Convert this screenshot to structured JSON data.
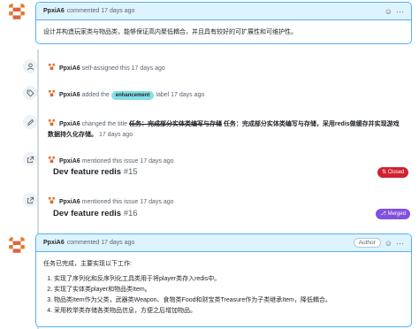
{
  "comment1": {
    "author": "PpxiA6",
    "meta": "commented 17 days ago",
    "body": "设计并构造玩家类与物品类，能够保证高内聚低耦合，并且具有较好的可扩展性和可维护性。",
    "actions_icon": "smiley-icon"
  },
  "events": {
    "assign": {
      "actor": "PpxiA6",
      "text": "self-assigned this 17 days ago"
    },
    "label": {
      "actor": "PpxiA6",
      "before": "added the",
      "label": "enhancement",
      "after": "label 17 days ago",
      "label_color": "#84e0e4"
    },
    "rename": {
      "actor": "PpxiA6",
      "before": "changed the title",
      "old_title": "任务：完成部分实体类编写与存储",
      "new_title": "任务：完成部分实体类编写与存储，采用redis做缓存并实现游戏数据持久化存储。",
      "after": "17 days ago"
    },
    "mention1": {
      "actor": "PpxiA6",
      "text": "mentioned this issue 17 days ago",
      "ref_title": "Dev feature redis",
      "ref_num": "#15",
      "state": "Closed"
    },
    "mention2": {
      "actor": "PpxiA6",
      "text": "mentioned this issue 17 days ago",
      "ref_title": "Dev feature redis",
      "ref_num": "#16",
      "state": "Merged"
    }
  },
  "comment2": {
    "author": "PpxiA6",
    "meta": "commented 17 days ago",
    "badge": "Author",
    "intro": "任务已完成，主要实现以下工作:",
    "items": [
      "实现了序列化和反序列化工具类用于将player类存入redis中。",
      "实现了实体类player和物品类Item。",
      "物品类Item作为父类，武器类Weapon、食物类Food和财宝类Treasure作为子类继承Item，降低耦合。",
      "采用枚举类存储各类物品信息，方便之后增加物品。"
    ]
  },
  "colors": {
    "closed": "#cf222e",
    "merged": "#8250df",
    "header_bg": "#ddf4ff",
    "border": "#54aeff"
  }
}
